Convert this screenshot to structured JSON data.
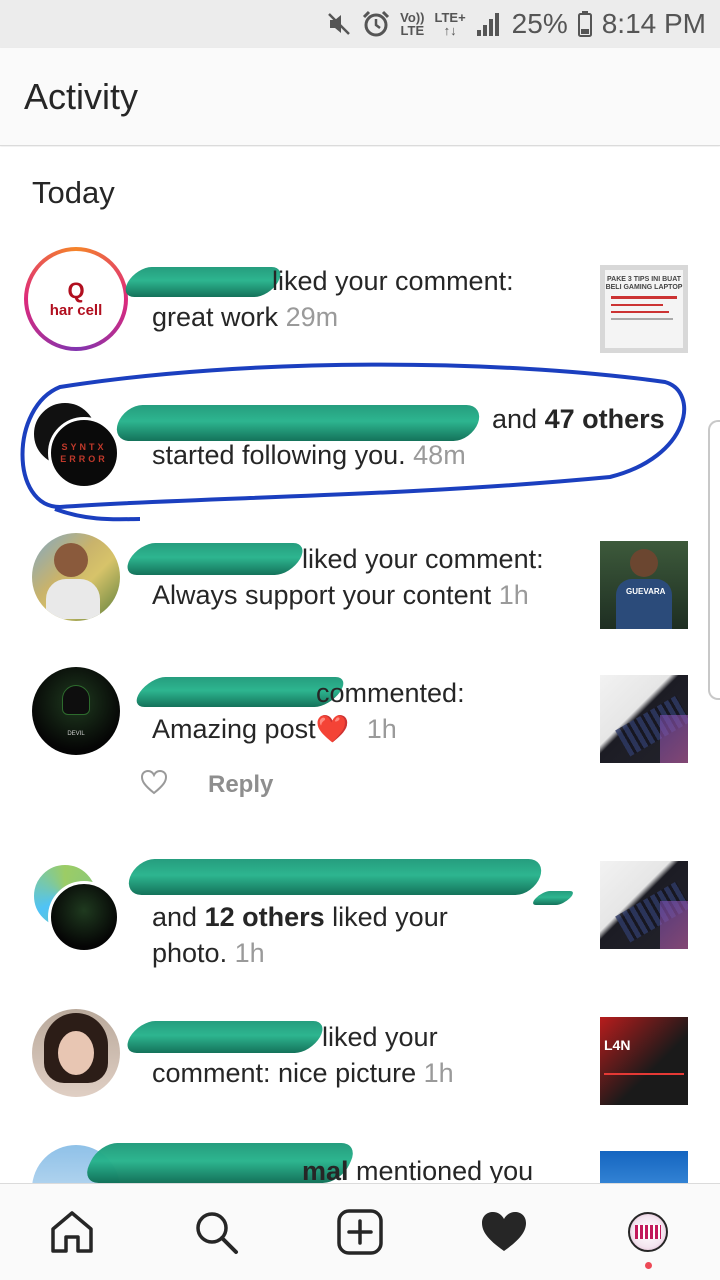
{
  "status_bar": {
    "volte_top": "Vo))",
    "volte_bottom": "LTE",
    "network_top": "LTE+",
    "network_bottom": "↑↓",
    "battery": "25%",
    "time": "8:14 PM",
    "icons": [
      "mute-icon",
      "alarm-icon",
      "signal-icon",
      "battery-icon"
    ]
  },
  "header": {
    "title": "Activity"
  },
  "feed": {
    "section_title": "Today",
    "items": [
      {
        "action": "liked your comment:",
        "detail": "great work",
        "time": "29m",
        "avatar_text": "har cell"
      },
      {
        "others_prefix": "and",
        "others_count": "47 others",
        "action": "started following you.",
        "time": "48m",
        "avatar_text": "SYNTX ERROR"
      },
      {
        "action": "liked your comment:",
        "detail": "Always support your content",
        "time": "1h"
      },
      {
        "action": "commented:",
        "detail": "Amazing post",
        "emoji": "❤️",
        "time": "1h",
        "reply_label": "Reply"
      },
      {
        "others_prefix": "and",
        "others_count": "12 others",
        "action": "liked your",
        "detail": "photo.",
        "time": "1h"
      },
      {
        "action": "liked your",
        "detail": "comment: nice picture",
        "time": "1h",
        "thumb_text": "L4N"
      },
      {
        "name_tail": "mal",
        "action": "mentioned you"
      }
    ]
  },
  "thumbs": {
    "laptop_tips_title": "PAKE 3 TIPS INI BUAT BELI GAMING LAPTOP",
    "guevara_text": "GUEVARA"
  },
  "bottom_nav": [
    "home-icon",
    "search-icon",
    "new-post-icon",
    "activity-heart-icon",
    "profile-avatar"
  ],
  "colors": {
    "accent": "#ed4956",
    "scribble": "#1f9a7a",
    "circle": "#1b3fbf",
    "meta": "#9a9a9a"
  }
}
